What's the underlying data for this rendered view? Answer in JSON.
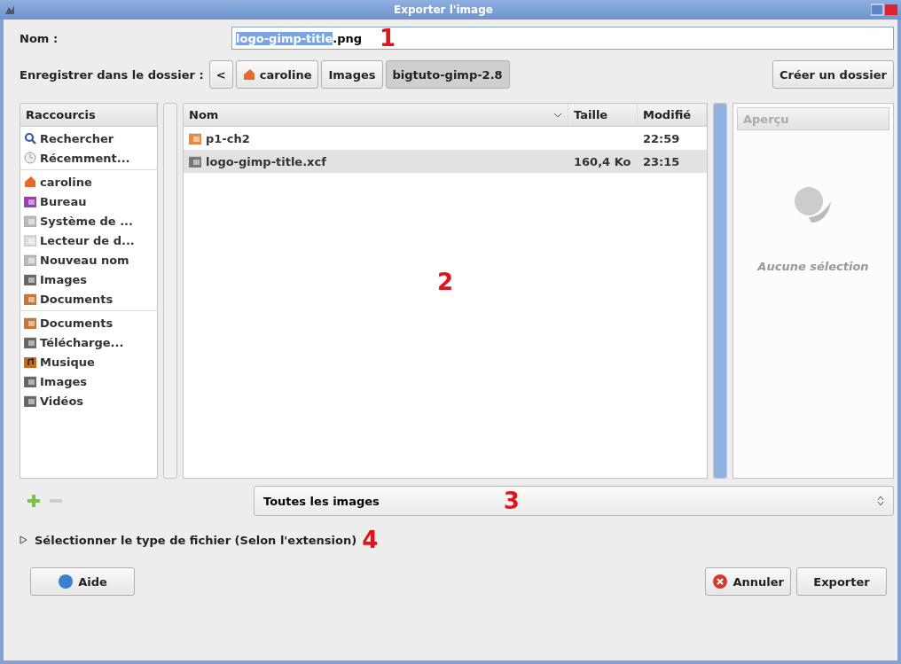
{
  "window": {
    "title": "Exporter l'image"
  },
  "name_field": {
    "label": "Nom :",
    "selected_part": "logo-gimp-title",
    "rest": ".png"
  },
  "folder": {
    "label": "Enregistrer dans le dossier :",
    "back": "<",
    "path": [
      {
        "label": "caroline",
        "kind": "home",
        "selected": false
      },
      {
        "label": "Images",
        "kind": "plain",
        "selected": false
      },
      {
        "label": "bigtuto-gimp-2.8",
        "kind": "plain",
        "selected": true
      }
    ],
    "create_button": "Créer un dossier"
  },
  "shortcuts": {
    "header": "Raccourcis",
    "sections": [
      [
        {
          "label": "Rechercher",
          "kind": "search"
        },
        {
          "label": "Récemment...",
          "kind": "recent"
        }
      ],
      [
        {
          "label": "caroline",
          "kind": "home"
        },
        {
          "label": "Bureau",
          "kind": "desktop"
        },
        {
          "label": "Système de ...",
          "kind": "drive"
        },
        {
          "label": "Lecteur de d...",
          "kind": "disc"
        },
        {
          "label": "Nouveau nom",
          "kind": "drive"
        },
        {
          "label": "Images",
          "kind": "pictures"
        },
        {
          "label": "Documents",
          "kind": "documents"
        }
      ],
      [
        {
          "label": "Documents",
          "kind": "documents"
        },
        {
          "label": "Télécharge...",
          "kind": "pictures"
        },
        {
          "label": "Musique",
          "kind": "music"
        },
        {
          "label": "Images",
          "kind": "pictures"
        },
        {
          "label": "Vidéos",
          "kind": "pictures"
        }
      ]
    ]
  },
  "files": {
    "columns": [
      "Nom",
      "Taille",
      "Modifié"
    ],
    "rows": [
      {
        "name": "p1-ch2",
        "kind": "folder",
        "size": "",
        "modified": "22:59",
        "selected": false
      },
      {
        "name": "logo-gimp-title.xcf",
        "kind": "image",
        "size": "160,4 Ko",
        "modified": "23:15",
        "selected": true
      }
    ]
  },
  "preview": {
    "header": "Aperçu",
    "message": "Aucune sélection"
  },
  "filter": {
    "value": "Toutes les images"
  },
  "expander": {
    "label": "Sélectionner le type de fichier (Selon l'extension)",
    "expanded": false
  },
  "buttons": {
    "help": "Aide",
    "cancel": "Annuler",
    "export": "Exporter"
  },
  "annotations": [
    "1",
    "2",
    "3",
    "4"
  ]
}
